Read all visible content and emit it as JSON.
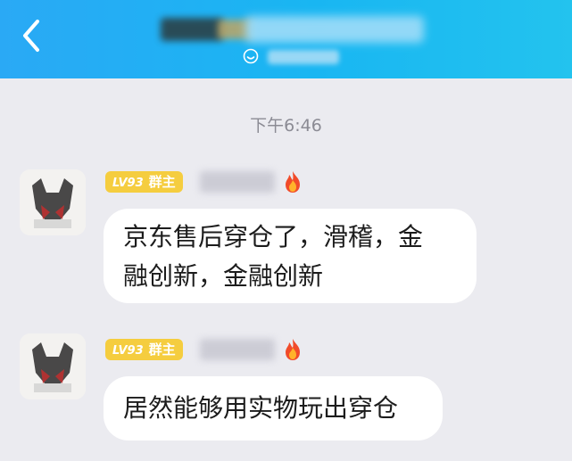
{
  "header": {
    "back_icon": "chevron-left-icon",
    "status_icon": "smile-icon"
  },
  "chat": {
    "timestamp": "下午6:46",
    "messages": [
      {
        "level": "LV93",
        "role": "群主",
        "badge_color": "#f5cd3f",
        "flair_icon": "fire-icon",
        "text_line1": "京东售后穿仓了，滑稽，金",
        "text_line2": "融创新，金融创新"
      },
      {
        "level": "LV93",
        "role": "群主",
        "badge_color": "#f5cd3f",
        "flair_icon": "fire-icon",
        "text_line1": "居然能够用实物玩出穿仓"
      }
    ]
  },
  "colors": {
    "header_blue": "#19b6f2",
    "background": "#ebebf0",
    "bubble": "#ffffff"
  }
}
